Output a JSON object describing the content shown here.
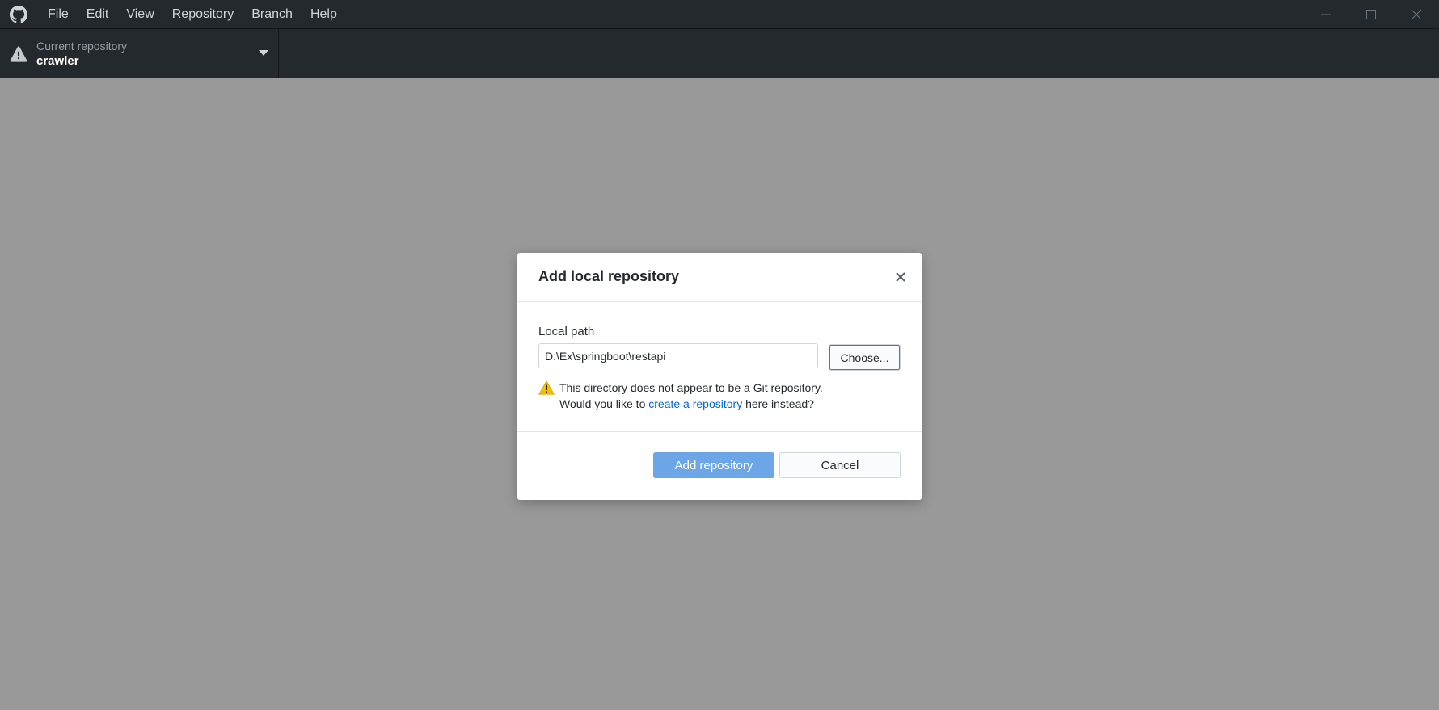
{
  "menu": [
    "File",
    "Edit",
    "View",
    "Repository",
    "Branch",
    "Help"
  ],
  "toolbar": {
    "repo_label": "Current repository",
    "repo_name": "crawler"
  },
  "dialog": {
    "title": "Add local repository",
    "field_label": "Local path",
    "path_value": "D:\\Ex\\springboot\\restapi",
    "choose_label": "Choose...",
    "warning_line1": "This directory does not appear to be a Git repository.",
    "warning_line2_pre": "Would you like to ",
    "warning_link": "create a repository",
    "warning_line2_post": " here instead?",
    "add_label": "Add repository",
    "cancel_label": "Cancel"
  },
  "icons": {
    "app": "github-icon",
    "warning": "warning-icon",
    "close": "close-icon"
  },
  "colors": {
    "titlebar": "#24292e",
    "primary_button": "#6ca6e6",
    "link": "#0366d6",
    "warning": "#f2c000"
  }
}
